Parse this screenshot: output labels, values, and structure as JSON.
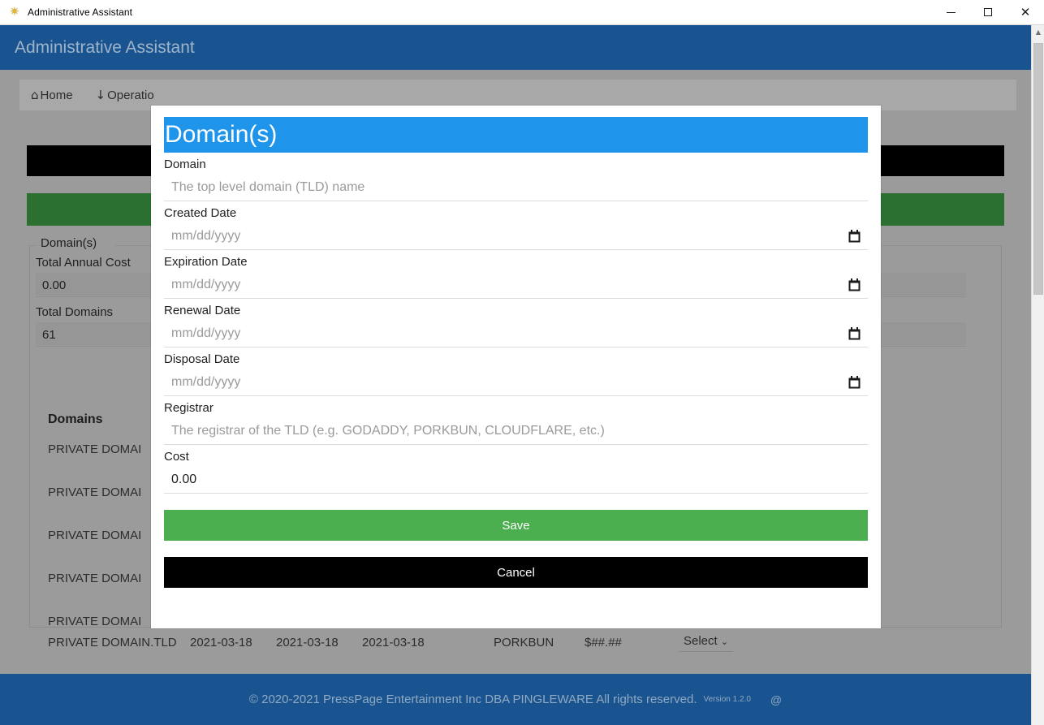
{
  "window": {
    "title": "Administrative Assistant",
    "icon": "star-icon",
    "minimize_label": "—",
    "maximize_label": "□",
    "close_label": "✕"
  },
  "app": {
    "header_title": "Administrative Assistant",
    "header_color": "#1a5490",
    "content_bg": "#9b9b9b"
  },
  "nav": {
    "tabs": [
      {
        "icon": "home-icon",
        "icon_glyph": "⌂",
        "label": "Home"
      },
      {
        "icon": "download-icon",
        "icon_glyph": "↓",
        "label": "Operatio"
      }
    ]
  },
  "background": {
    "bar_black_color": "#000000",
    "bar_green_color": "#2b7030",
    "fieldset_legend": "Domain(s)",
    "stats": [
      {
        "label": "Total Annual Cost",
        "value": "0.00"
      },
      {
        "label": "Total Domains",
        "value": "61"
      }
    ],
    "table": {
      "heading": "Domains",
      "partial_rows": [
        "PRIVATE DOMAI",
        "PRIVATE DOMAI",
        "PRIVATE DOMAI",
        "PRIVATE DOMAI",
        "PRIVATE DOMAI"
      ],
      "full_row": {
        "name": "PRIVATE DOMAIN.TLD",
        "created": "2021-03-18",
        "expiration": "2021-03-18",
        "renewal": "2021-03-18",
        "registrar": "PORKBUN",
        "cost": "$##.##",
        "select_label": "Select",
        "select_chevron": "⌄"
      }
    }
  },
  "footer": {
    "copyright": "© 2020-2021 PressPage Entertainment Inc DBA PINGLEWARE  All rights reserved.",
    "version": "Version 1.2.0",
    "at_symbol": "@"
  },
  "scrollbar": {
    "up_arrow": "▲"
  },
  "modal": {
    "title": "Domain(s)",
    "header_color": "#1e95eb",
    "fields": [
      {
        "label": "Domain",
        "value": "",
        "placeholder": "The top level domain (TLD) name",
        "type": "text",
        "name": "domain"
      },
      {
        "label": "Created Date",
        "value": "",
        "placeholder": "mm/dd/yyyy",
        "type": "date",
        "name": "created-date"
      },
      {
        "label": "Expiration Date",
        "value": "",
        "placeholder": "mm/dd/yyyy",
        "type": "date",
        "name": "expiration-date"
      },
      {
        "label": "Renewal Date",
        "value": "",
        "placeholder": "mm/dd/yyyy",
        "type": "date",
        "name": "renewal-date"
      },
      {
        "label": "Disposal Date",
        "value": "",
        "placeholder": "mm/dd/yyyy",
        "type": "date",
        "name": "disposal-date"
      },
      {
        "label": "Registrar",
        "value": "",
        "placeholder": "The registrar of the TLD (e.g. GODADDY, PORKBUN, CLOUDFLARE, etc.)",
        "type": "text",
        "name": "registrar"
      },
      {
        "label": "Cost",
        "value": "0.00",
        "placeholder": "",
        "type": "text",
        "name": "cost"
      }
    ],
    "save_label": "Save",
    "cancel_label": "Cancel",
    "save_color": "#4bae4f",
    "cancel_color": "#000000"
  }
}
